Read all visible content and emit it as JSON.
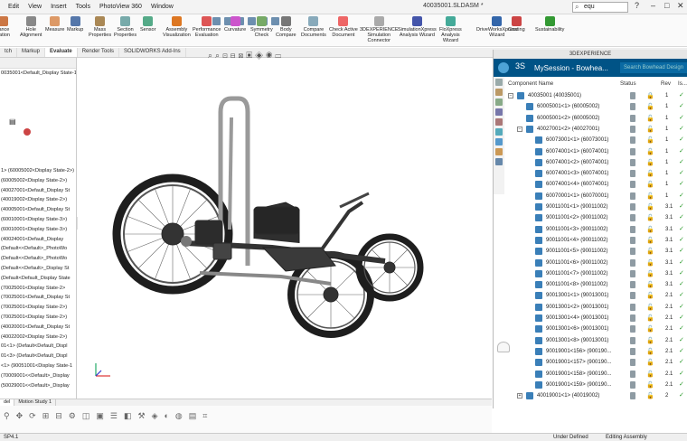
{
  "menu": {
    "items": [
      "Edit",
      "View",
      "Insert",
      "Tools",
      "PhotoView 360",
      "Window"
    ],
    "document_title": "40035001.SLDASM *",
    "search_value": "equ"
  },
  "ribbon": {
    "buttons": [
      {
        "label": "rance\nuation",
        "icon": "interference-icon"
      },
      {
        "label": "Hole\nAlignment",
        "icon": "hole-icon"
      },
      {
        "label": "Measure",
        "icon": "measure-icon"
      },
      {
        "label": "Markup",
        "icon": "markup-icon"
      },
      {
        "label": "Mass\nProperties",
        "icon": "mass-icon"
      },
      {
        "label": "Section\nProperties",
        "icon": "section-icon"
      },
      {
        "label": "Sensor",
        "icon": "sensor-icon"
      },
      {
        "label": "Assembly\nVisualization",
        "icon": "assembly-icon"
      },
      {
        "label": "Performance\nEvaluation",
        "icon": "performance-icon"
      },
      {
        "label": "Curvature",
        "icon": "curvature-icon"
      },
      {
        "label": "Symmetry\nCheck",
        "icon": "symmetry-icon"
      },
      {
        "label": "Body\nCompare",
        "icon": "body-compare-icon"
      },
      {
        "label": "Compare\nDocuments",
        "icon": "compare-icon"
      },
      {
        "label": "Check Active\nDocument",
        "icon": "check-icon"
      },
      {
        "label": "3DEXPERIENCE\nSimulation\nConnector",
        "icon": "sim-connector-icon"
      },
      {
        "label": "SimulationXpress\nAnalysis Wizard",
        "icon": "simxpress-icon"
      },
      {
        "label": "FloXpress\nAnalysis\nWizard",
        "icon": "floxpress-icon"
      },
      {
        "label": "DriveWorksXpress\nWizard",
        "icon": "driveworks-icon"
      },
      {
        "label": "Costing",
        "icon": "costing-icon"
      },
      {
        "label": "Sustainability",
        "icon": "sustainability-icon"
      }
    ]
  },
  "tabs": [
    "tch",
    "Markup",
    "Evaluate",
    "Render Tools",
    "SOLIDWORKS Add-Ins"
  ],
  "active_tab": "Evaluate",
  "tree_left": [
    "0035001<Default_Display State-1",
    "",
    "",
    "",
    "",
    "",
    "",
    "",
    "",
    "",
    "1> (60005002<Display State-2>)",
    "(60005002<Display State-2>)",
    "(40027001<Default_Display St",
    "(40019002<Display State-2>)",
    "(40005001<Default_Display St",
    "(60010001<Display State-3>)",
    "(60010001<Display State-3>)",
    "(40024001<Default_Display",
    "(Default<<Default>_PhotoWo",
    "(Default<<Default>_PhotoWo",
    "(Default<<Default>_Display St",
    "(Default<Default_Display State",
    "(70025001<Display State-2>",
    "(70025001<Default_Display St",
    "(70025001<Display State-2>)",
    "(70025001<Display State-2>)",
    "(40020001<Default_Display St",
    "(40022002<Display State-2>)",
    "01<1> (Default<Default_Displ",
    "01<3> (Default<Default_Displ",
    "<1> (90051001<Display State-1",
    "(70009001<<Default>_Display",
    "(50029001<<Default>_Display"
  ],
  "bottom_tabs": [
    "del",
    "Motion Study 1"
  ],
  "status_bar": {
    "left": "SP4.1",
    "mid": "Under Defined",
    "right": "Editing Assembly"
  },
  "panel": {
    "header": "3DEXPERIENCE",
    "session": "MySession - Bowhea...",
    "search_placeholder": "Search Bowhead Design",
    "columns": {
      "name": "Component Name",
      "status": "Status",
      "rev": "Rev",
      "is": "Is..."
    },
    "rows": [
      {
        "name": "40035001 (40035001)",
        "level": 0,
        "expand": "−",
        "rev": "1",
        "lock": "locked"
      },
      {
        "name": "60005001<1> (60005002)",
        "level": 1,
        "expand": "",
        "rev": "1",
        "lock": "open"
      },
      {
        "name": "60005001<2> (60005002)",
        "level": 1,
        "expand": "",
        "rev": "1",
        "lock": "open"
      },
      {
        "name": "40027001<2> (40027001)",
        "level": 1,
        "expand": "−",
        "rev": "1",
        "lock": "open"
      },
      {
        "name": "60073001<1> (60073001)",
        "level": 2,
        "expand": "",
        "rev": "1",
        "lock": "open"
      },
      {
        "name": "60074001<1> (60074001)",
        "level": 2,
        "expand": "",
        "rev": "1",
        "lock": "open"
      },
      {
        "name": "60074001<2> (60074001)",
        "level": 2,
        "expand": "",
        "rev": "1",
        "lock": "open"
      },
      {
        "name": "60074001<3> (60074001)",
        "level": 2,
        "expand": "",
        "rev": "1",
        "lock": "open"
      },
      {
        "name": "60074001<4> (60074001)",
        "level": 2,
        "expand": "",
        "rev": "1",
        "lock": "open"
      },
      {
        "name": "60070001<1> (60070001)",
        "level": 2,
        "expand": "",
        "rev": "1",
        "lock": "open"
      },
      {
        "name": "90011001<1> (90011002)",
        "level": 2,
        "expand": "",
        "rev": "3.1",
        "lock": "open"
      },
      {
        "name": "90011001<2> (90011002)",
        "level": 2,
        "expand": "",
        "rev": "3.1",
        "lock": "open"
      },
      {
        "name": "90011001<3> (90011002)",
        "level": 2,
        "expand": "",
        "rev": "3.1",
        "lock": "open"
      },
      {
        "name": "90011001<4> (90011002)",
        "level": 2,
        "expand": "",
        "rev": "3.1",
        "lock": "open"
      },
      {
        "name": "90011001<5> (90011002)",
        "level": 2,
        "expand": "",
        "rev": "3.1",
        "lock": "open"
      },
      {
        "name": "90011001<6> (90011002)",
        "level": 2,
        "expand": "",
        "rev": "3.1",
        "lock": "open"
      },
      {
        "name": "90011001<7> (90011002)",
        "level": 2,
        "expand": "",
        "rev": "3.1",
        "lock": "open"
      },
      {
        "name": "90011001<8> (90011002)",
        "level": 2,
        "expand": "",
        "rev": "3.1",
        "lock": "open"
      },
      {
        "name": "90013001<1> (90013001)",
        "level": 2,
        "expand": "",
        "rev": "2.1",
        "lock": "open"
      },
      {
        "name": "90013001<2> (90013001)",
        "level": 2,
        "expand": "",
        "rev": "2.1",
        "lock": "open"
      },
      {
        "name": "90013001<4> (90013001)",
        "level": 2,
        "expand": "",
        "rev": "2.1",
        "lock": "open"
      },
      {
        "name": "90013001<6> (90013001)",
        "level": 2,
        "expand": "",
        "rev": "2.1",
        "lock": "open"
      },
      {
        "name": "90013001<8> (90013001)",
        "level": 2,
        "expand": "",
        "rev": "2.1",
        "lock": "open"
      },
      {
        "name": "90019001<156> (900190...",
        "level": 2,
        "expand": "",
        "rev": "2.1",
        "lock": "open"
      },
      {
        "name": "90019001<157> (900190...",
        "level": 2,
        "expand": "",
        "rev": "2.1",
        "lock": "open"
      },
      {
        "name": "90019001<158> (900190...",
        "level": 2,
        "expand": "",
        "rev": "2.1",
        "lock": "open"
      },
      {
        "name": "90019001<159> (900190...",
        "level": 2,
        "expand": "",
        "rev": "2.1",
        "lock": "open"
      },
      {
        "name": "40019001<1> (40019002)",
        "level": 1,
        "expand": "+",
        "rev": "2",
        "lock": "open"
      }
    ]
  },
  "colors": {
    "panel_bar": "#005386",
    "check": "#2a9a2a",
    "part_icon": "#3a7fb8"
  }
}
